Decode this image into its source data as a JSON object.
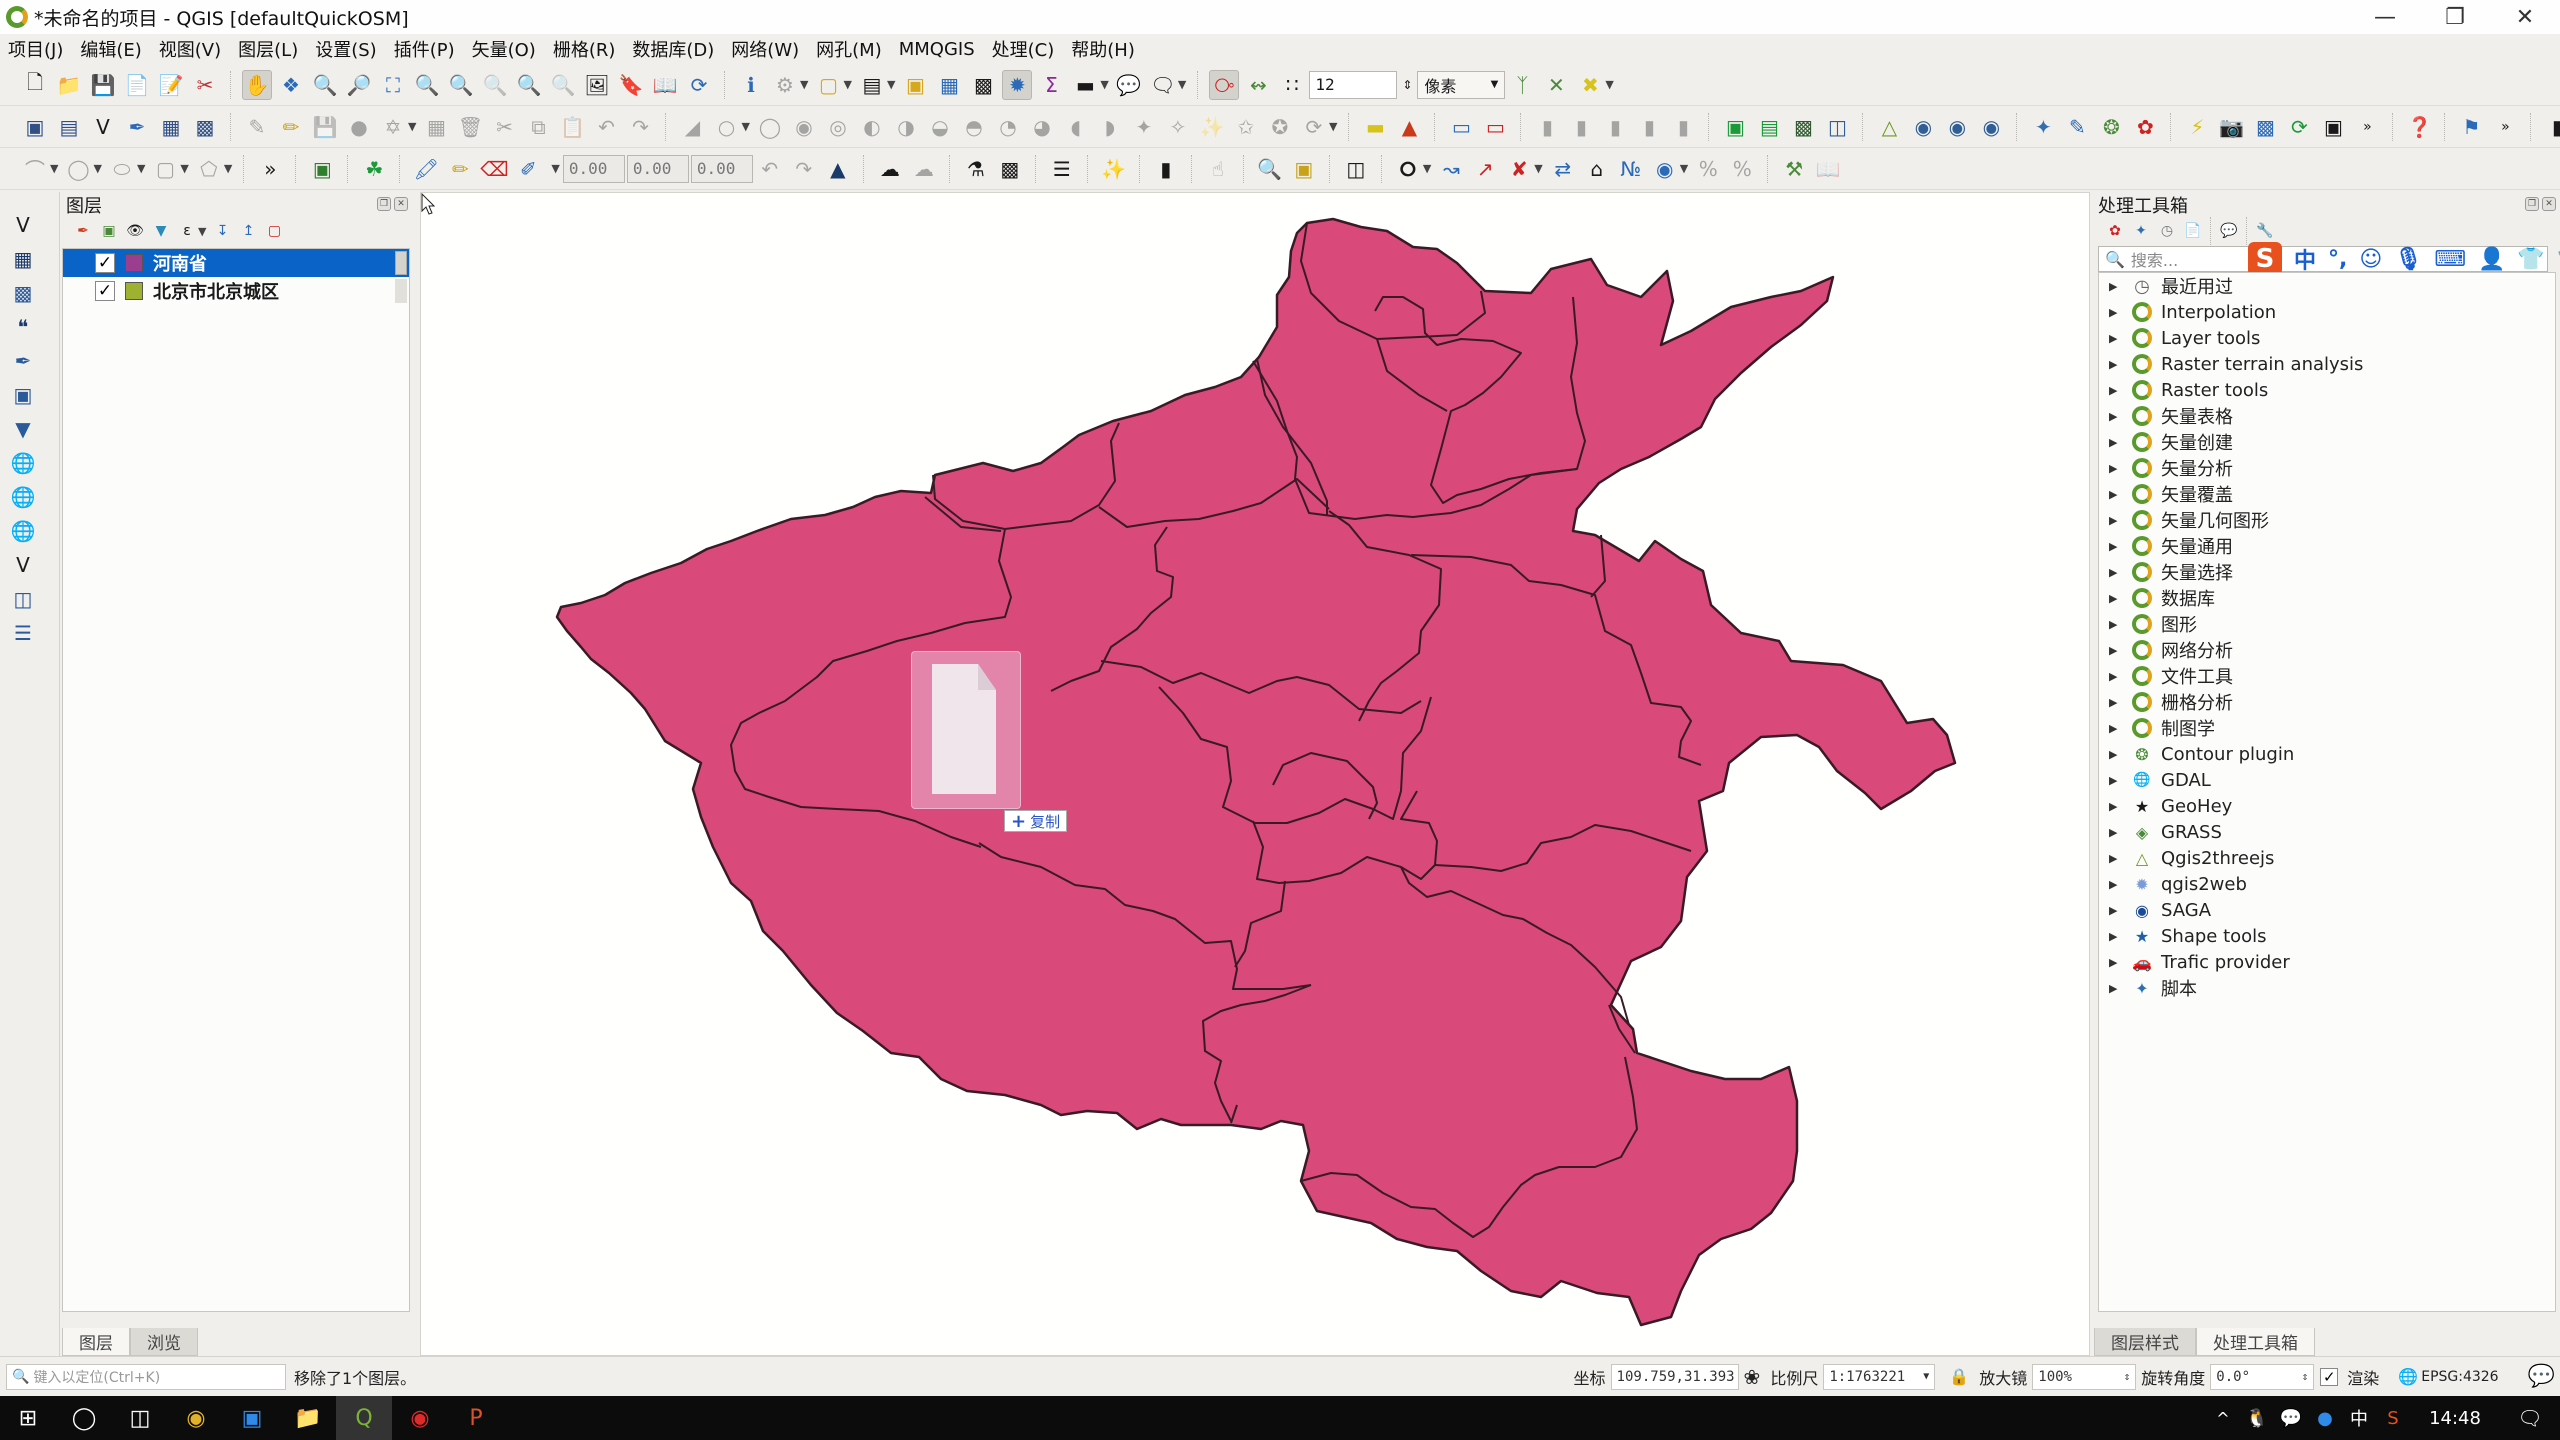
{
  "window": {
    "title": "*未命名的项目 - QGIS [defaultQuickOSM]",
    "controls": [
      "minimize",
      "restore",
      "close"
    ]
  },
  "menu": [
    "项目(J)",
    "编辑(E)",
    "视图(V)",
    "图层(L)",
    "设置(S)",
    "插件(P)",
    "矢量(O)",
    "栅格(R)",
    "数据库(D)",
    "网络(W)",
    "网孔(M)",
    "MMQGIS",
    "处理(C)",
    "帮助(H)"
  ],
  "toolbar": {
    "snap_tolerance": "12",
    "snap_unit": "像素",
    "rotate_x": "0.00",
    "rotate_y": "0.00",
    "rotate_z": "0.00"
  },
  "layers_panel": {
    "title": "图层",
    "layers": [
      {
        "name": "河南省",
        "checked": true,
        "color": "#9b3e8f",
        "selected": true
      },
      {
        "name": "北京市北京城区",
        "checked": true,
        "color": "#9fb130",
        "selected": false
      }
    ],
    "tabs": [
      "图层",
      "浏览"
    ],
    "active_tab": "图层"
  },
  "canvas": {
    "fill_color": "#d9497a",
    "drag_label": "复制"
  },
  "toolbox_panel": {
    "title": "处理工具箱",
    "search_placeholder": "搜索...",
    "items": [
      {
        "label": "最近用过",
        "icon": "clock"
      },
      {
        "label": "Interpolation",
        "icon": "qgis"
      },
      {
        "label": "Layer tools",
        "icon": "qgis"
      },
      {
        "label": "Raster terrain analysis",
        "icon": "qgis"
      },
      {
        "label": "Raster tools",
        "icon": "qgis"
      },
      {
        "label": "矢量表格",
        "icon": "qgis"
      },
      {
        "label": "矢量创建",
        "icon": "qgis"
      },
      {
        "label": "矢量分析",
        "icon": "qgis"
      },
      {
        "label": "矢量覆盖",
        "icon": "qgis"
      },
      {
        "label": "矢量几何图形",
        "icon": "qgis"
      },
      {
        "label": "矢量通用",
        "icon": "qgis"
      },
      {
        "label": "矢量选择",
        "icon": "qgis"
      },
      {
        "label": "数据库",
        "icon": "qgis"
      },
      {
        "label": "图形",
        "icon": "qgis"
      },
      {
        "label": "网络分析",
        "icon": "qgis"
      },
      {
        "label": "文件工具",
        "icon": "qgis"
      },
      {
        "label": "栅格分析",
        "icon": "qgis"
      },
      {
        "label": "制图学",
        "icon": "qgis"
      },
      {
        "label": "Contour plugin",
        "icon": "contour"
      },
      {
        "label": "GDAL",
        "icon": "gdal"
      },
      {
        "label": "GeoHey",
        "icon": "geohey"
      },
      {
        "label": "GRASS",
        "icon": "grass"
      },
      {
        "label": "Qgis2threejs",
        "icon": "triangle"
      },
      {
        "label": "qgis2web",
        "icon": "gear"
      },
      {
        "label": "SAGA",
        "icon": "saga"
      },
      {
        "label": "Shape tools",
        "icon": "star"
      },
      {
        "label": "Trafic provider",
        "icon": "car"
      },
      {
        "label": "脚本",
        "icon": "python"
      }
    ],
    "tabs": [
      "图层样式",
      "处理工具箱"
    ],
    "active_tab": "处理工具箱"
  },
  "statusbar": {
    "locate_placeholder": "键入以定位(Ctrl+K)",
    "message": "移除了1个图层。",
    "coord_label": "坐标",
    "coord_value": "109.759,31.393",
    "scale_label": "比例尺",
    "scale_value": "1:1763221",
    "magnifier_label": "放大镜",
    "magnifier_value": "100%",
    "rotation_label": "旋转角度",
    "rotation_value": "0.0°",
    "render_label": "渲染",
    "render_checked": true,
    "crs": "EPSG:4326"
  },
  "taskbar": {
    "clock": "14:48",
    "ime": "中"
  }
}
